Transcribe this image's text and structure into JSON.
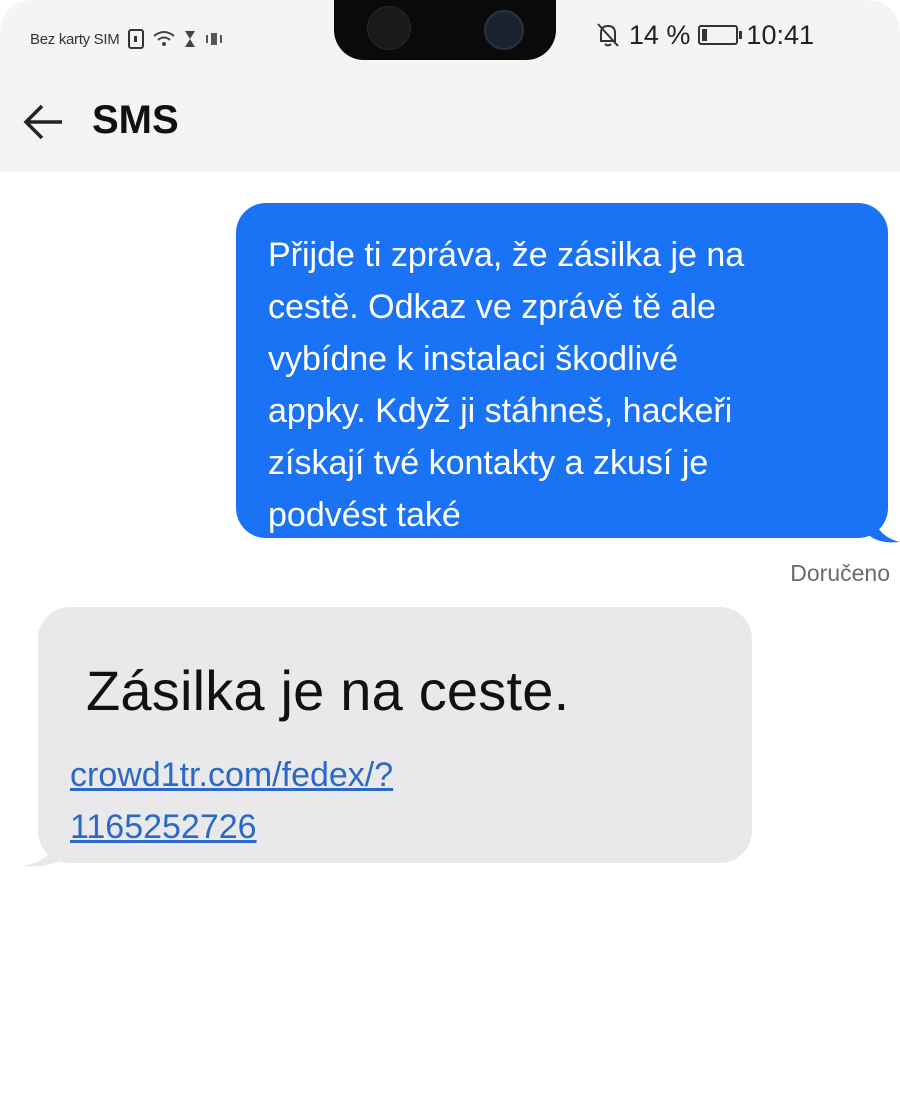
{
  "status_bar": {
    "carrier": "Bez karty SIM",
    "battery": "14 %",
    "time": "10:41"
  },
  "header": {
    "title": "SMS"
  },
  "messages": {
    "outgoing": {
      "lines": [
        "Přijde ti zpráva, že zásilka je na",
        "cestě. Odkaz ve zprávě tě ale",
        "vybídne k instalaci škodlivé",
        "appky. Když ji stáhneš, hackeři",
        "získají tvé kontakty a zkusí je",
        "podvést také"
      ],
      "status": "Doručeno"
    },
    "incoming": {
      "text": "Zásilka je na ceste.",
      "link_lines": [
        "crowd1tr.com/fedex/?",
        "1165252726"
      ]
    }
  },
  "colors": {
    "outgoing_bubble": "#1a73f5",
    "incoming_bubble": "#e9e9eb",
    "link": "#2a69c7"
  }
}
